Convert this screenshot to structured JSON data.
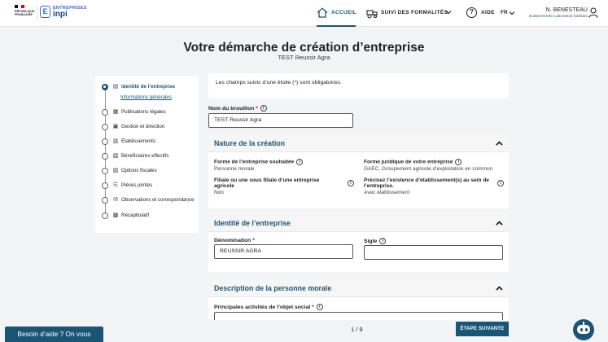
{
  "header": {
    "republique": [
      "RÉPUBLIQUE",
      "FRANÇAISE"
    ],
    "inpi_top": "ENTREPRISES",
    "inpi_bottom": "inpi",
    "inpi_e": "E",
    "nav": {
      "accueil": "ACCUEIL",
      "suivi": "SUIVI DES FORMALITÉS",
      "aide": "AIDE",
      "lang": "FR"
    },
    "user": {
      "name": "N. BENESTEAU",
      "org": "Euskal Herriko Laborantza Ganbara"
    }
  },
  "page": {
    "title": "Votre démarche de création d’entreprise",
    "subtitle": "TEST Reussir Agra"
  },
  "sidebar": {
    "items": [
      {
        "label": "Identité de l’entreprise",
        "icon": "document-icon",
        "glyph": "▤"
      },
      {
        "label": "Publications légales",
        "icon": "newspaper-icon",
        "glyph": "▦"
      },
      {
        "label": "Gestion et direction",
        "icon": "people-icon",
        "glyph": "▣"
      },
      {
        "label": "Établissements",
        "icon": "building-icon",
        "glyph": "▥"
      },
      {
        "label": "Bénéficiaires effectifs",
        "icon": "clipboard-icon",
        "glyph": "▧"
      },
      {
        "label": "Options fiscales",
        "icon": "tax-icon",
        "glyph": "▨"
      },
      {
        "label": "Pièces jointes",
        "icon": "attachment-icon",
        "glyph": "⎘"
      },
      {
        "label": "Observations et correspondance",
        "icon": "chat-icon",
        "glyph": "✉"
      },
      {
        "label": "Récapitulatif",
        "icon": "summary-icon",
        "glyph": "▩"
      }
    ],
    "subitem": "Informations générales"
  },
  "notice": {
    "before": "Les champs suivis d’une étoile (",
    "star": "*",
    "after": ") sont obligatoires."
  },
  "brouillon": {
    "label": "Nom du brouillon",
    "value": "TEST Reussir Agra"
  },
  "nature": {
    "title": "Nature de la création",
    "forme_label": "Forme de l’entreprise souhaitée",
    "forme_value": "Personne morale",
    "juridique_label": "Forme juridique de votre entreprise",
    "juridique_value": "GAEC, Groupement agricole d’exploitation en commun",
    "filiale_label": "Filiale ou une sous filiale d’une entreprise agricole",
    "filiale_value": "Non",
    "existence_label": "Précisez l’existence d’établissement(s) au sein de l’entreprise.",
    "existence_value": "Avec établissement"
  },
  "identite": {
    "title": "Identité de l’entreprise",
    "denomination_label": "Dénomination",
    "denomination_value": "REUSSIR AGRA",
    "sigle_label": "Sigle",
    "sigle_value": ""
  },
  "description": {
    "title": "Description de la personne morale",
    "activites_label": "Principales activités de l’objet social"
  },
  "footer": {
    "pager": "1 / 9",
    "next": "ÉTAPE SUIVANTE",
    "help": "Besoin d’aide ? On vous rappelle !"
  },
  "colors": {
    "primary": "#1a5576",
    "accent_blue": "#2f6cd8",
    "required": "#c00000"
  }
}
